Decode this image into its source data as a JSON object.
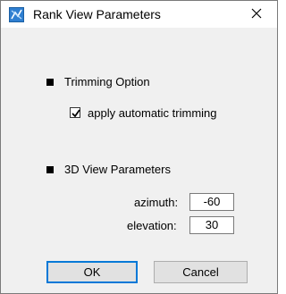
{
  "window": {
    "title": "Rank View Parameters",
    "app_icon": "app-icon"
  },
  "trimming": {
    "section_label": "Trimming Option",
    "checkbox_label": "apply automatic trimming",
    "checked": true
  },
  "view3d": {
    "section_label": "3D View Parameters",
    "azimuth_label": "azimuth:",
    "azimuth_value": "-60",
    "elevation_label": "elevation:",
    "elevation_value": "30"
  },
  "buttons": {
    "ok_label": "OK",
    "cancel_label": "Cancel"
  },
  "colors": {
    "dialog_bg": "#f0f0f0",
    "titlebar_bg": "#ffffff",
    "default_button_border": "#0078d7"
  }
}
